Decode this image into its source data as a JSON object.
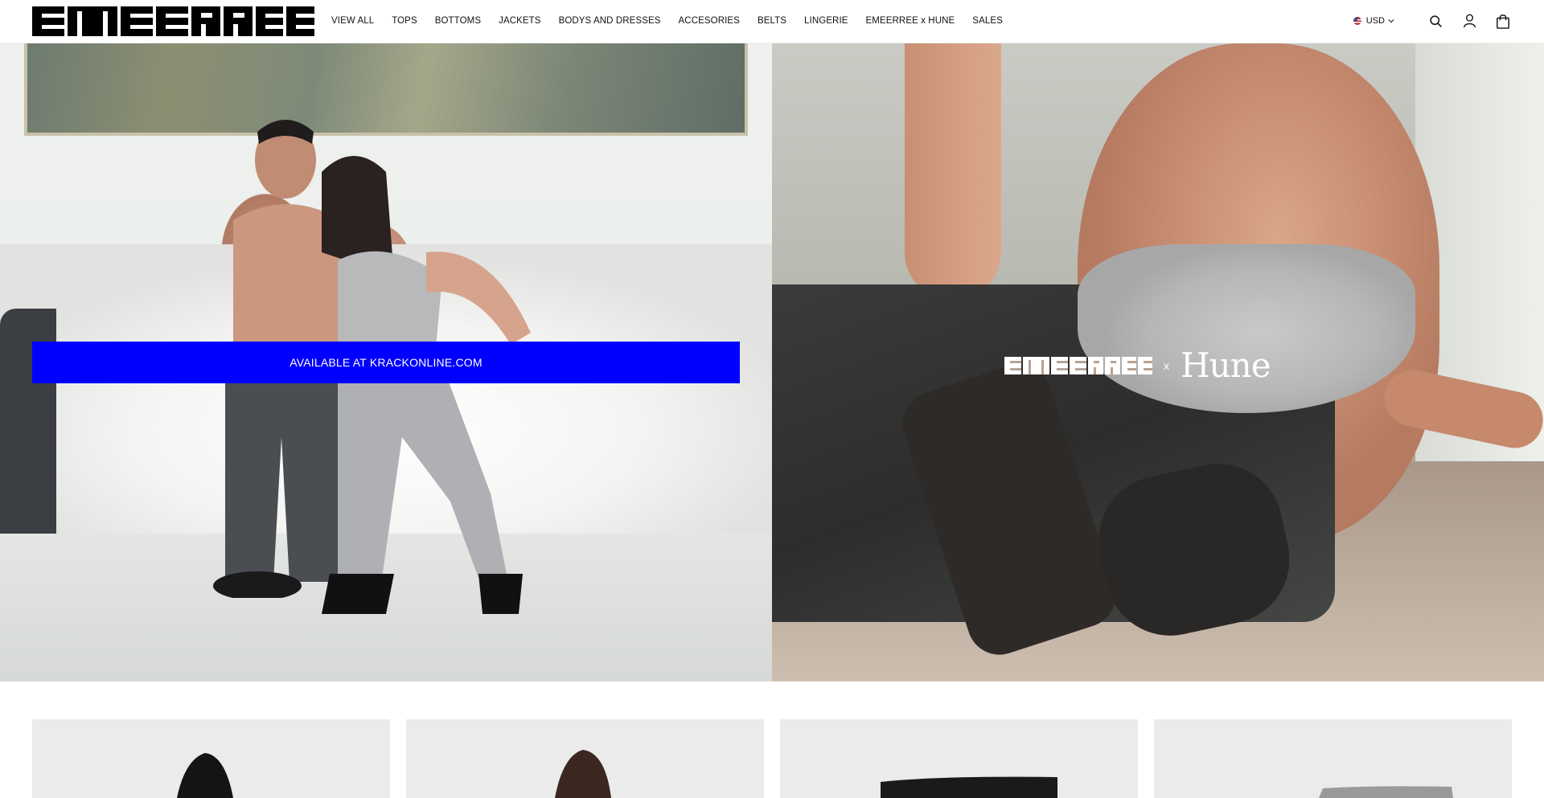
{
  "brand": {
    "logo_text": "EMEERREE"
  },
  "nav": {
    "items": [
      {
        "label": "VIEW ALL"
      },
      {
        "label": "TOPS"
      },
      {
        "label": "BOTTOMS"
      },
      {
        "label": "JACKETS"
      },
      {
        "label": "BODYS AND DRESSES"
      },
      {
        "label": "ACCESORIES"
      },
      {
        "label": "BELTS"
      },
      {
        "label": "LINGERIE"
      },
      {
        "label": "EMEERREE x HUNE"
      },
      {
        "label": "SALES"
      }
    ]
  },
  "tools": {
    "currency": "USD",
    "icons": [
      "search-icon",
      "account-icon",
      "cart-icon"
    ]
  },
  "hero": {
    "left": {
      "cta_label": "AVAILABLE AT KRACKONLINE.COM"
    },
    "right": {
      "brand": "EMEERREE",
      "x": "x",
      "partner": "Hune"
    }
  },
  "colors": {
    "cta": "#0000ff",
    "background": "#ffffff",
    "product_bg": "#ebebeb"
  }
}
